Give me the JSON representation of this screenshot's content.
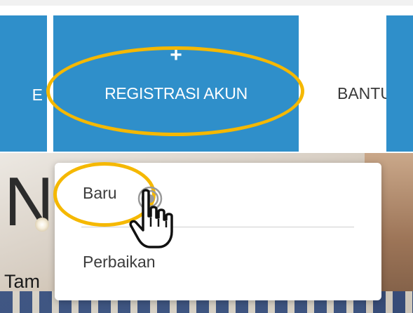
{
  "nav": {
    "left_partial_label": "E",
    "active_item_icon": "plus-icon",
    "active_item_label": "REGISTRASI AKUN",
    "help_partial_label": "BANTU",
    "accent_color": "#2f8fca"
  },
  "dropdown": {
    "items": [
      {
        "label": "Baru"
      },
      {
        "label": "Perbaikan"
      }
    ]
  },
  "hero": {
    "partial_heading": "N",
    "partial_text": "Tam"
  },
  "annotations": {
    "highlight_color": "#f5b800",
    "cursor": "hand-pointer-icon",
    "click_indicator": "click-ripple-icon"
  }
}
